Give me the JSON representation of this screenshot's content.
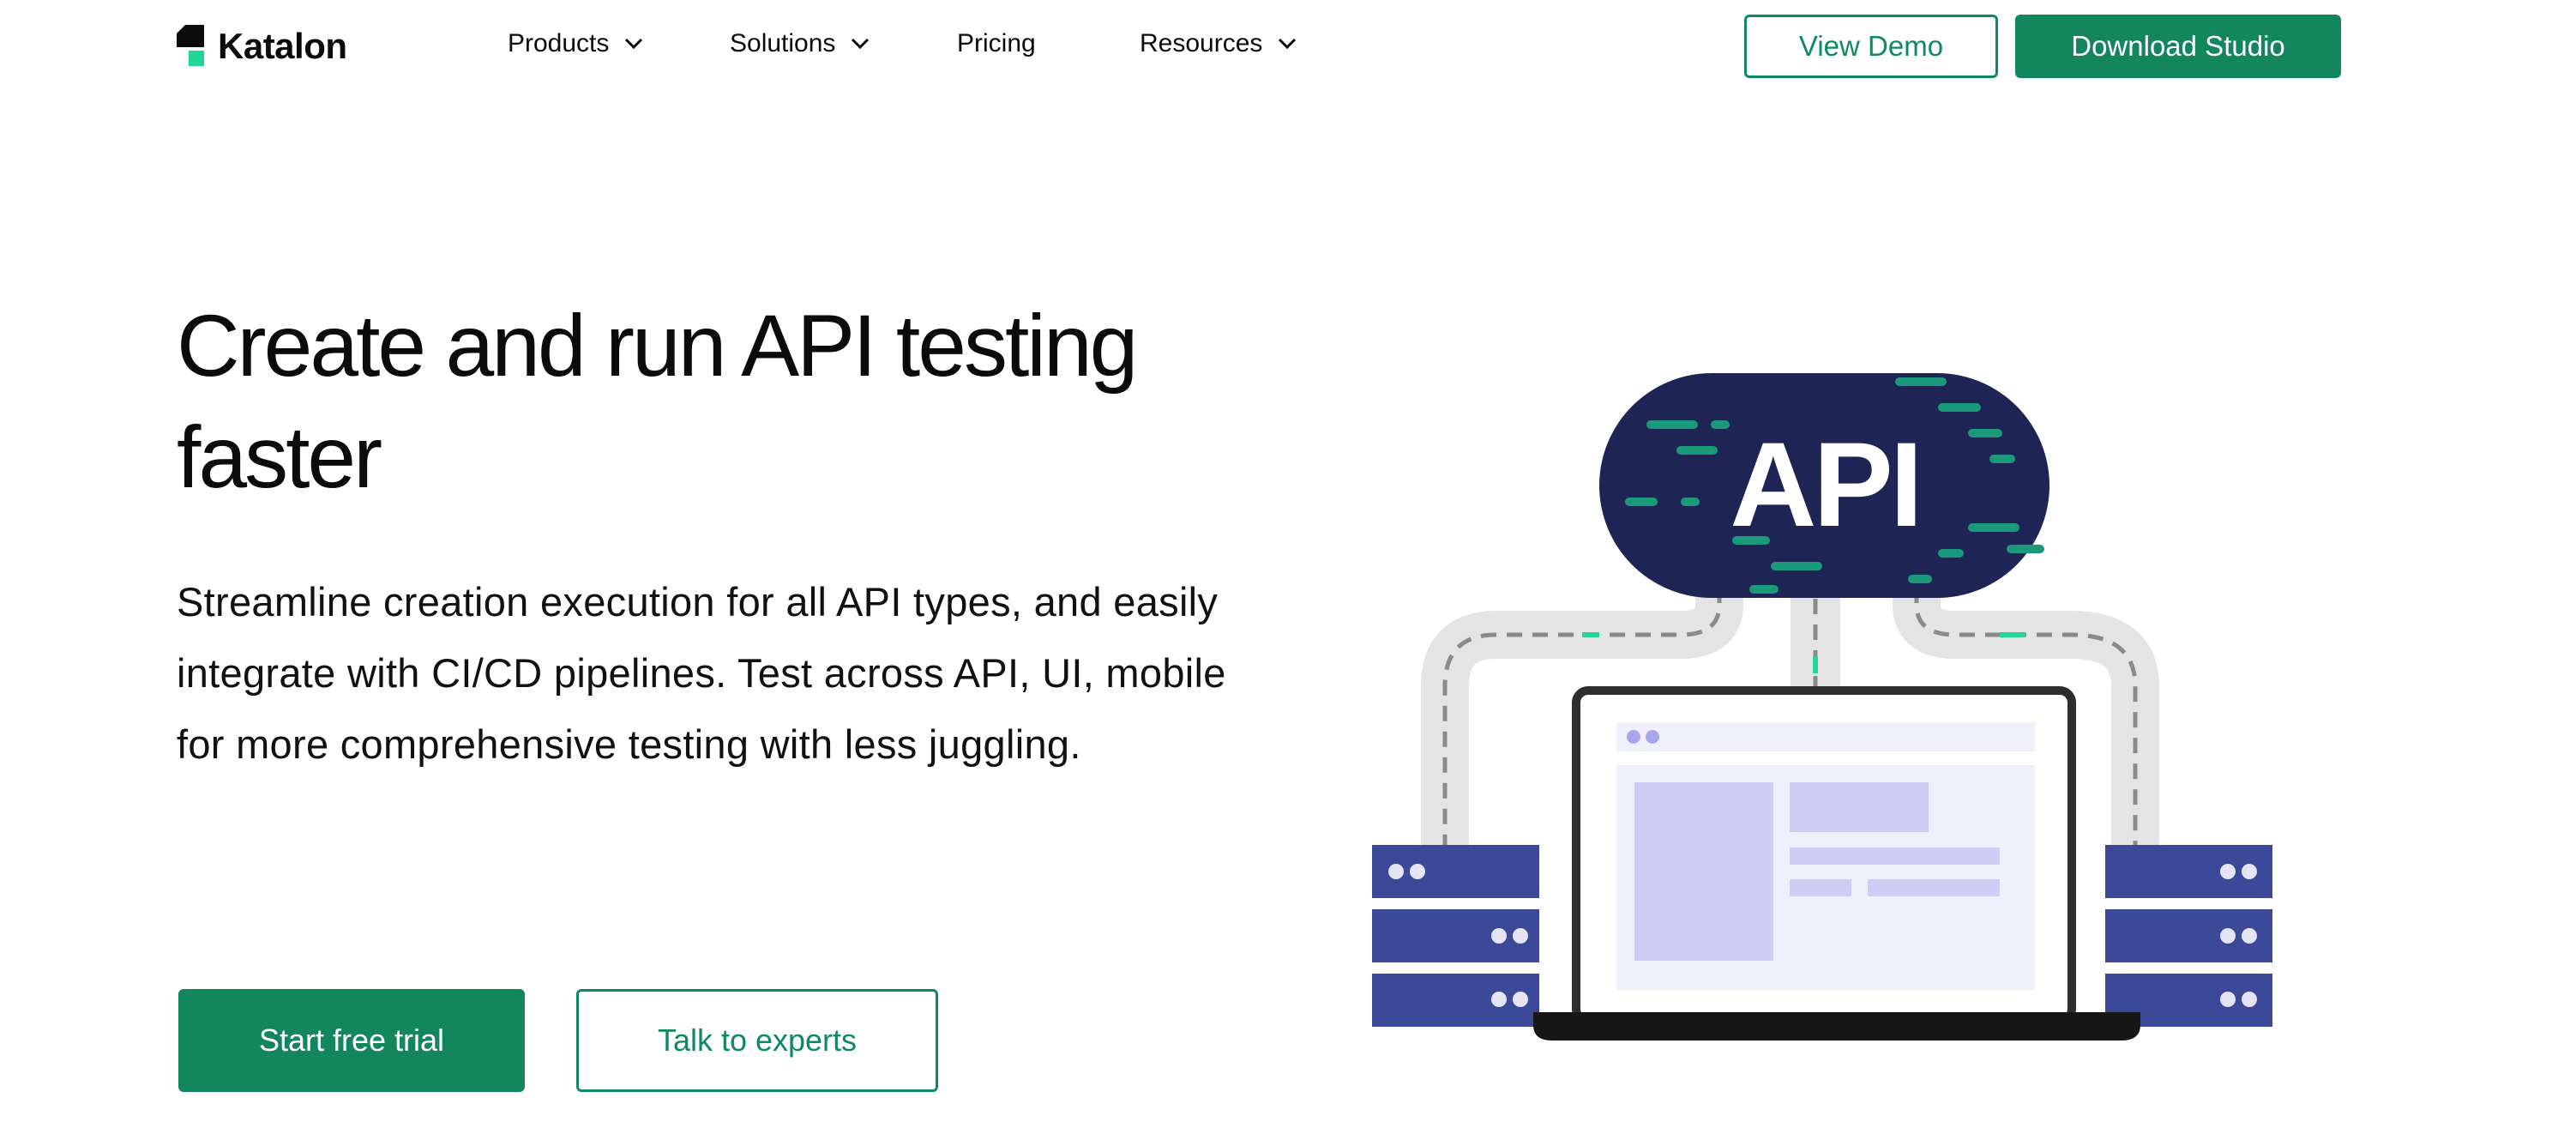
{
  "brand": {
    "name": "Katalon",
    "accent": "#14865e",
    "mark_color": "#21d59b"
  },
  "nav": {
    "items": [
      {
        "label": "Products",
        "has_dropdown": true
      },
      {
        "label": "Solutions",
        "has_dropdown": true
      },
      {
        "label": "Pricing",
        "has_dropdown": false
      },
      {
        "label": "Resources",
        "has_dropdown": true
      }
    ],
    "view_demo": "View Demo",
    "download": "Download Studio"
  },
  "hero": {
    "title": "Create and run API testing faster",
    "subtitle": "Streamline creation execution for all API types, and easily integrate with CI/CD pipelines. Test across API, UI, mobile for more comprehensive testing with less juggling.",
    "primary_cta": "Start free trial",
    "secondary_cta": "Talk to experts"
  },
  "illustration": {
    "badge_text": "API",
    "badge_color": "#1f2457",
    "server_color": "#3c4898",
    "screen_accent": "#cdcdf6"
  }
}
